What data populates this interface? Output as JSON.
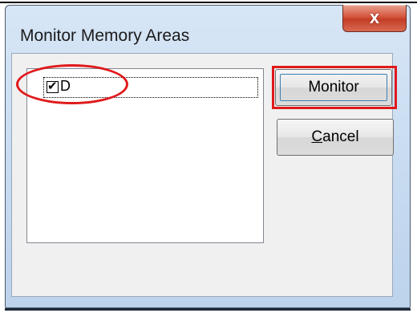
{
  "window": {
    "title": "Monitor Memory Areas",
    "close_glyph": "x"
  },
  "memory_areas": {
    "items": [
      {
        "label": "D",
        "checked": true,
        "check_glyph": "✔"
      }
    ]
  },
  "buttons": {
    "monitor_label": "Monitor",
    "cancel_mnemonic": "C",
    "cancel_rest": "ancel"
  },
  "annotations": {
    "color": "#e0191b"
  }
}
